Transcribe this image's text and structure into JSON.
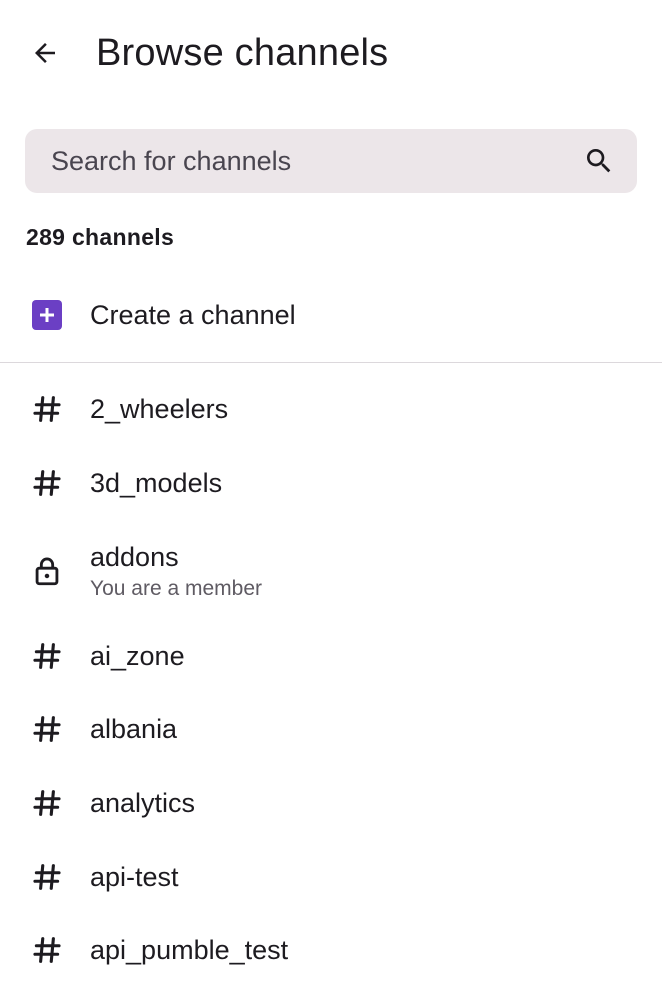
{
  "header": {
    "title": "Browse channels",
    "back_icon": "arrow-left-icon"
  },
  "search": {
    "placeholder": "Search for channels",
    "value": "",
    "icon": "search-icon"
  },
  "summary": {
    "count_label": "289 channels"
  },
  "create": {
    "label": "Create a channel",
    "icon": "plus-square-icon",
    "icon_color": "#6b3fc4"
  },
  "channels": [
    {
      "name": "2_wheelers",
      "icon": "hash-icon",
      "subtitle": ""
    },
    {
      "name": "3d_models",
      "icon": "hash-icon",
      "subtitle": ""
    },
    {
      "name": "addons",
      "icon": "lock-icon",
      "subtitle": "You are a member"
    },
    {
      "name": "ai_zone",
      "icon": "hash-icon",
      "subtitle": ""
    },
    {
      "name": "albania",
      "icon": "hash-icon",
      "subtitle": ""
    },
    {
      "name": "analytics",
      "icon": "hash-icon",
      "subtitle": ""
    },
    {
      "name": "api-test",
      "icon": "hash-icon",
      "subtitle": ""
    },
    {
      "name": "api_pumble_test",
      "icon": "hash-icon",
      "subtitle": ""
    }
  ]
}
